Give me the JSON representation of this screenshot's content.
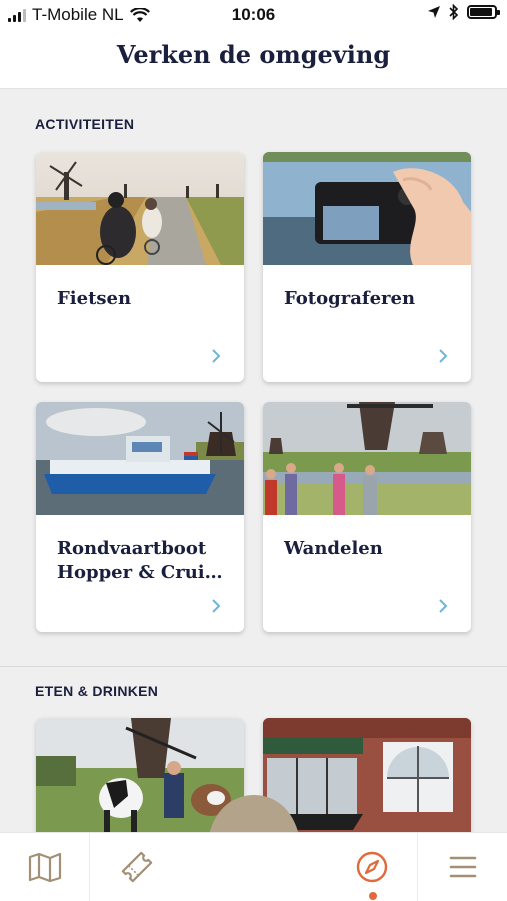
{
  "statusbar": {
    "carrier": "T-Mobile NL",
    "time": "10:06"
  },
  "header": {
    "title": "Verken de omgeving"
  },
  "sections": [
    {
      "title": "ACTIVITEITEN",
      "cards": [
        {
          "label": "Fietsen"
        },
        {
          "label": "Fotograferen"
        },
        {
          "label": "Rondvaartboot\nHopper & Crui…"
        },
        {
          "label": "Wandelen"
        }
      ]
    },
    {
      "title": "ETEN & DRINKEN"
    }
  ],
  "tabbar": {
    "items": [
      {
        "icon": "map-icon"
      },
      {
        "icon": "ticket-icon"
      },
      {
        "icon": "headphones-icon"
      },
      {
        "icon": "compass-icon",
        "active": true
      },
      {
        "icon": "menu-icon"
      }
    ]
  },
  "colors": {
    "accent": "#e06a3b",
    "brand": "#1b1f3e",
    "tab_icon": "#a38f74",
    "audio_bg": "#b3a38a",
    "chevron": "#6db6d8"
  }
}
